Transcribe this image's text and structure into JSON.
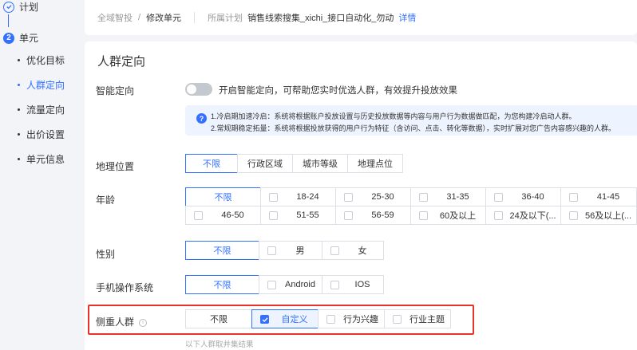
{
  "sidebar": {
    "steps": [
      {
        "label": "计划",
        "number": ""
      },
      {
        "label": "单元",
        "number": "2"
      }
    ],
    "sub_items": [
      {
        "label": "优化目标",
        "active": false
      },
      {
        "label": "人群定向",
        "active": true
      },
      {
        "label": "流量定向",
        "active": false
      },
      {
        "label": "出价设置",
        "active": false
      },
      {
        "label": "单元信息",
        "active": false
      }
    ]
  },
  "header": {
    "breadcrumb_root": "全域智投",
    "breadcrumb_sep": "/",
    "breadcrumb_current": "修改单元",
    "plan_label": "所属计划",
    "plan_name": "销售线索搜集_xichi_接口自动化_勿动",
    "plan_detail": "详情"
  },
  "main": {
    "title": "人群定向",
    "smart": {
      "label": "智能定向",
      "toggle_text": "开启智能定向，可帮助您实时优选人群，有效提升投放效果",
      "info_line1": "1.冷启期加速冷启：系统将根据账户投放设置与历史投放数据等内容与用户行为数据做匹配，为您构建冷启动人群。",
      "info_line2": "2.常规期稳定拓量：系统将根据投放获得的用户行为特征（含访问、点击、转化等数据），实时扩展对您广告内容感兴趣的人群。"
    },
    "location": {
      "label": "地理位置",
      "options": [
        "不限",
        "行政区域",
        "城市等级",
        "地理点位"
      ]
    },
    "age": {
      "label": "年龄",
      "unlimited": "不限",
      "row1": [
        "18-24",
        "25-30",
        "31-35",
        "36-40",
        "41-45"
      ],
      "row2": [
        "46-50",
        "51-55",
        "56-59",
        "60及以上",
        "24及以下(...",
        "56及以上(..."
      ]
    },
    "gender": {
      "label": "性别",
      "unlimited": "不限",
      "options": [
        "男",
        "女"
      ]
    },
    "os": {
      "label": "手机操作系统",
      "unlimited": "不限",
      "options": [
        "Android",
        "IOS"
      ]
    },
    "focus": {
      "label": "侧重人群",
      "info_icon": "i",
      "unlimited": "不限",
      "options": [
        "自定义",
        "行为兴趣",
        "行业主题"
      ],
      "footnote": "以下人群取并集结果"
    }
  },
  "colors": {
    "accent": "#3370ff",
    "highlight": "#e8332c"
  }
}
